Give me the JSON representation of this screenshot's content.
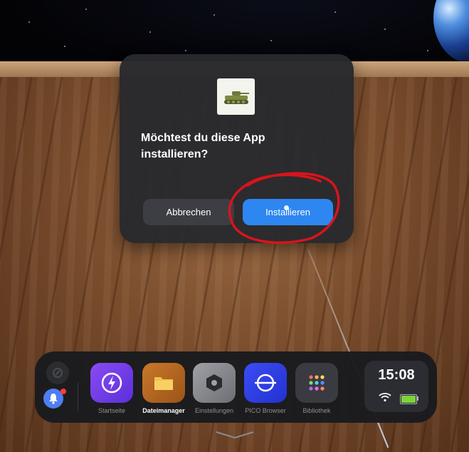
{
  "dialog": {
    "title": "Möchtest du diese App installieren?",
    "app_icon": "tank-icon",
    "cancel_label": "Abbrechen",
    "install_label": "Installieren"
  },
  "dock": {
    "items": [
      {
        "label": "Startseite",
        "icon": "lightning-icon",
        "color": "#7b3ff2"
      },
      {
        "label": "Dateimanager",
        "icon": "folder-icon",
        "color": "#b86a1f",
        "active": true
      },
      {
        "label": "Einstellungen",
        "icon": "hexagon-settings-icon",
        "color": "#8a8b90"
      },
      {
        "label": "PICO Browser",
        "icon": "browser-globe-icon",
        "color": "#2f3ff0"
      },
      {
        "label": "Bibliothek",
        "icon": "grid-icon",
        "color": "#3a3b40"
      }
    ],
    "clock": {
      "time": "15:08"
    },
    "battery_level": 1.0,
    "notification_icon": "bell-icon"
  },
  "colors": {
    "accent": "#2e86f0",
    "annotation": "#d8141c",
    "battery": "#7ad43a"
  }
}
